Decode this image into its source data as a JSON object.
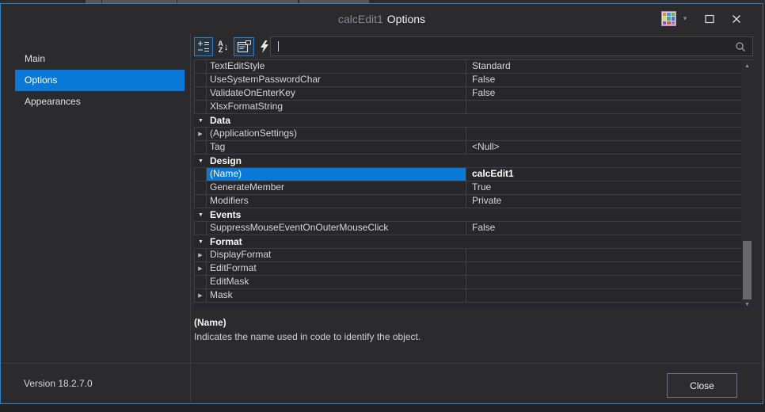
{
  "window": {
    "title_dim": "calcEdit1",
    "title_main": "Options",
    "palette_colors": [
      "#d98c3f",
      "#4f94d9",
      "#6fae4a",
      "#e6d44f",
      "#41a8a0",
      "#4f6fd9",
      "#8a4fd9",
      "#d95f3f",
      "#a06fd9"
    ]
  },
  "sidebar": {
    "items": [
      {
        "label": "Main",
        "selected": false
      },
      {
        "label": "Options",
        "selected": true
      },
      {
        "label": "Appearances",
        "selected": false
      }
    ]
  },
  "toolbar": {
    "buttons": [
      {
        "name": "categorized-view",
        "toggled": true
      },
      {
        "name": "alphabetical-sort",
        "toggled": false
      },
      {
        "name": "property-pages",
        "toggled": true
      },
      {
        "name": "show-events",
        "toggled": false
      }
    ],
    "search": {
      "value": "",
      "placeholder": ""
    }
  },
  "property_grid": {
    "rows": [
      {
        "type": "property",
        "name": "TextEditStyle",
        "value": "Standard"
      },
      {
        "type": "property",
        "name": "UseSystemPasswordChar",
        "value": "False"
      },
      {
        "type": "property",
        "name": "ValidateOnEnterKey",
        "value": "False"
      },
      {
        "type": "property",
        "name": "XlsxFormatString",
        "value": ""
      },
      {
        "type": "category",
        "name": "Data"
      },
      {
        "type": "property",
        "name": "(ApplicationSettings)",
        "value": "",
        "expandable": true
      },
      {
        "type": "property",
        "name": "Tag",
        "value": "<Null>"
      },
      {
        "type": "category",
        "name": "Design"
      },
      {
        "type": "property",
        "name": "(Name)",
        "value": "calcEdit1",
        "selected": true,
        "value_bold": true
      },
      {
        "type": "property",
        "name": "GenerateMember",
        "value": "True"
      },
      {
        "type": "property",
        "name": "Modifiers",
        "value": "Private"
      },
      {
        "type": "category",
        "name": "Events"
      },
      {
        "type": "property",
        "name": "SuppressMouseEventOnOuterMouseClick",
        "value": "False"
      },
      {
        "type": "category",
        "name": "Format"
      },
      {
        "type": "property",
        "name": "DisplayFormat",
        "value": "",
        "expandable": true
      },
      {
        "type": "property",
        "name": "EditFormat",
        "value": "",
        "expandable": true
      },
      {
        "type": "property",
        "name": "EditMask",
        "value": ""
      },
      {
        "type": "property",
        "name": "Mask",
        "value": "",
        "expandable": true
      }
    ]
  },
  "description": {
    "title": "(Name)",
    "text": "Indicates the name used in code to identify the object."
  },
  "footer": {
    "version": "Version 18.2.7.0",
    "close_label": "Close"
  },
  "colors": {
    "accent": "#0a78d7",
    "window_border": "#2e80c4",
    "background": "#2b2b2e",
    "grid_background": "#27272b",
    "grid_line": "#3e3e43"
  }
}
